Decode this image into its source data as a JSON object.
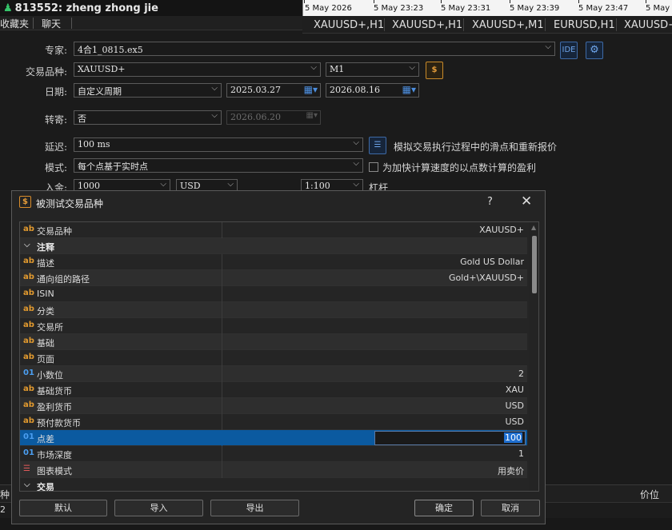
{
  "terminal": {
    "account": "813552: zheng zhong jie",
    "left_tabs": [
      "收藏夹",
      "聊天"
    ],
    "time_ticks": [
      "5 May 2026",
      "5 May 23:23",
      "5 May 23:31",
      "5 May 23:39",
      "5 May 23:47",
      "5 May 2"
    ],
    "chart_tabs": [
      "XAUUSD+,H1",
      "XAUUSD+,H1",
      "XAUUSD+,M1",
      "EURUSD,H1",
      "XAUUSD+"
    ],
    "bottom_left_1": "种",
    "bottom_left_2": "2",
    "bottom_right": "价位"
  },
  "settings": {
    "expert_label": "专家:",
    "expert_value": "4合1_0815.ex5",
    "symbol_label": "交易品种:",
    "symbol_value": "XAUUSD+",
    "timeframe_value": "M1",
    "date_label": "日期:",
    "date_mode": "自定义周期",
    "date_from": "2025.03.27",
    "date_to": "2026.08.16",
    "forward_label": "转寄:",
    "forward_value": "否",
    "forward_date": "2026.06.20",
    "delay_label": "延迟:",
    "delay_value": "100 ms",
    "delay_desc": "模拟交易执行过程中的滑点和重新报价",
    "model_label": "模式:",
    "model_value": "每个点基于实时点",
    "model_desc": "为加快计算速度的以点数计算的盈利",
    "deposit_label": "入金:",
    "deposit_value": "1000",
    "currency_value": "USD",
    "leverage_value": "1:100",
    "leverage_label": "杠杆",
    "ide_label": "IDE"
  },
  "dialog": {
    "title": "被测试交易品种",
    "help": "?",
    "close": "✕",
    "rows": [
      {
        "type": "ab",
        "name": "交易品种",
        "value": "XAUUSD+"
      },
      {
        "type": "group",
        "name": "注释",
        "value": ""
      },
      {
        "type": "ab",
        "name": "描述",
        "value": "Gold US Dollar"
      },
      {
        "type": "ab",
        "name": "通向组的路径",
        "value": "Gold+\\XAUUSD+"
      },
      {
        "type": "ab",
        "name": "ISIN",
        "value": ""
      },
      {
        "type": "ab",
        "name": "分类",
        "value": ""
      },
      {
        "type": "ab",
        "name": "交易所",
        "value": ""
      },
      {
        "type": "ab",
        "name": "基础",
        "value": ""
      },
      {
        "type": "ab",
        "name": "页面",
        "value": ""
      },
      {
        "type": "01",
        "name": "小数位",
        "value": "2"
      },
      {
        "type": "ab",
        "name": "基础货币",
        "value": "XAU"
      },
      {
        "type": "ab",
        "name": "盈利货币",
        "value": "USD"
      },
      {
        "type": "ab",
        "name": "预付款货币",
        "value": "USD"
      },
      {
        "type": "01",
        "name": "点差",
        "value": "100",
        "selected": true
      },
      {
        "type": "01",
        "name": "市场深度",
        "value": "1"
      },
      {
        "type": "mode",
        "name": "图表模式",
        "value": "用卖价"
      },
      {
        "type": "group",
        "name": "交易",
        "value": ""
      }
    ],
    "buttons": {
      "default": "默认",
      "import": "导入",
      "export": "导出",
      "ok": "确定",
      "cancel": "取消"
    }
  },
  "colors": {
    "accent": "#0b5aa0",
    "ab_icon": "#e29a2f",
    "num_icon": "#4b9ef0"
  }
}
